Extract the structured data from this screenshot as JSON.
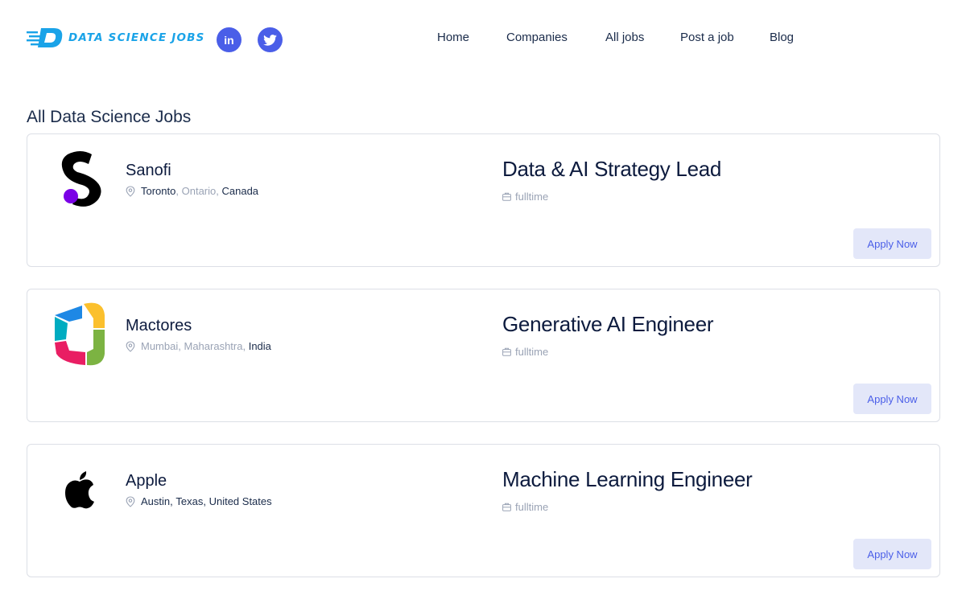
{
  "brand": {
    "name": "DATA SCIENCE JOBS"
  },
  "social": [
    {
      "name": "linkedin",
      "label": "in"
    },
    {
      "name": "twitter",
      "label": ""
    }
  ],
  "nav": [
    {
      "label": "Home"
    },
    {
      "label": "Companies"
    },
    {
      "label": "All jobs"
    },
    {
      "label": "Post a job"
    },
    {
      "label": "Blog"
    }
  ],
  "page": {
    "title": "All Data Science Jobs"
  },
  "jobs": [
    {
      "company": "Sanofi",
      "logo_icon": "sanofi-logo",
      "location": {
        "city": "Toronto",
        "region": "Ontario",
        "country": "Canada"
      },
      "title": "Data & AI Strategy Lead",
      "type": "fulltime",
      "apply_label": "Apply Now"
    },
    {
      "company": "Mactores",
      "logo_icon": "mactores-logo",
      "location": {
        "city": "Mumbai",
        "region": "Maharashtra",
        "country": "India"
      },
      "title": "Generative AI Engineer",
      "type": "fulltime",
      "apply_label": "Apply Now"
    },
    {
      "company": "Apple",
      "logo_icon": "apple-logo",
      "location": {
        "city": "Austin",
        "region": "Texas",
        "country": "United States"
      },
      "title": "Machine Learning Engineer",
      "type": "fulltime",
      "apply_label": "Apply Now"
    }
  ],
  "colors": {
    "accent": "#4a5ee8",
    "brand": "#1aa3e8",
    "apply_bg": "#e3e7f9",
    "text": "#0d1b3e"
  }
}
